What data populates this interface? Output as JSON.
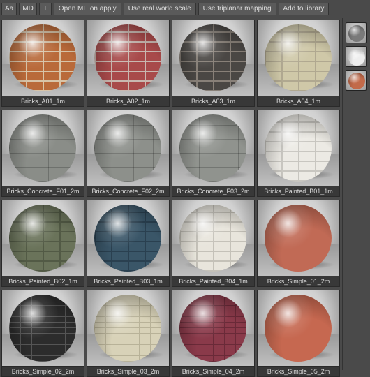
{
  "toolbar": {
    "aa": "Aa",
    "md": "MD",
    "info": "I",
    "open_me": "Open ME on apply",
    "real_world": "Use real world scale",
    "triplanar": "Use triplanar mapping",
    "add_lib": "Add to library"
  },
  "materials": [
    {
      "label": "Bricks_A01_1m",
      "pattern": "brick",
      "base": "#b96a3a",
      "mortar": "#d8c4a8"
    },
    {
      "label": "Bricks_A02_1m",
      "pattern": "brick",
      "base": "#a84a4a",
      "mortar": "#c9b8b0"
    },
    {
      "label": "Bricks_A03_1m",
      "pattern": "brick",
      "base": "#4a4744",
      "mortar": "#888078"
    },
    {
      "label": "Bricks_A04_1m",
      "pattern": "brick",
      "base": "#cfc8a8",
      "mortar": "#b0a890"
    },
    {
      "label": "Bricks_Concrete_F01_2m",
      "pattern": "concrete",
      "base": "#8a8d88",
      "mortar": "#6b6e68"
    },
    {
      "label": "Bricks_Concrete_F02_2m",
      "pattern": "concrete",
      "base": "#8d908b",
      "mortar": "#6e716b"
    },
    {
      "label": "Bricks_Concrete_F03_2m",
      "pattern": "concrete",
      "base": "#90938e",
      "mortar": "#71746e"
    },
    {
      "label": "Bricks_Painted_B01_1m",
      "pattern": "brick",
      "base": "#eceae4",
      "mortar": "#c8c6c0"
    },
    {
      "label": "Bricks_Painted_B02_1m",
      "pattern": "brick",
      "base": "#6a735a",
      "mortar": "#525a45"
    },
    {
      "label": "Bricks_Painted_B03_1m",
      "pattern": "brick",
      "base": "#3a5668",
      "mortar": "#2a4050"
    },
    {
      "label": "Bricks_Painted_B04_1m",
      "pattern": "brick",
      "base": "#e8e5dc",
      "mortar": "#c4c1b8"
    },
    {
      "label": "Bricks_Simple_01_2m",
      "pattern": "plain",
      "base": "#c16a55",
      "mortar": "#a05040"
    },
    {
      "label": "Bricks_Simple_02_2m",
      "pattern": "fine",
      "base": "#2c2c2c",
      "mortar": "#555555"
    },
    {
      "label": "Bricks_Simple_03_2m",
      "pattern": "fine",
      "base": "#d8d2b8",
      "mortar": "#b8b298"
    },
    {
      "label": "Bricks_Simple_04_2m",
      "pattern": "fine",
      "base": "#8a3a4a",
      "mortar": "#6a2a38"
    },
    {
      "label": "Bricks_Simple_05_2m",
      "pattern": "plain",
      "base": "#c66850",
      "mortar": "#a55040"
    }
  ],
  "side_thumbs": [
    {
      "base": "#7a7a7a"
    },
    {
      "base": "#eeeeee"
    },
    {
      "base": "#c26a4a"
    }
  ]
}
